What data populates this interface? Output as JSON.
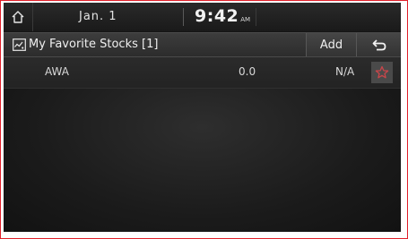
{
  "status_bar": {
    "home_icon": "home-icon",
    "date": "Jan.  1",
    "time": "9:42",
    "ampm": "AM"
  },
  "title_bar": {
    "list_icon": "stock-list-icon",
    "title": "My Favorite Stocks [1]",
    "add_label": "Add",
    "back_icon": "back-arrow-icon"
  },
  "stocks": [
    {
      "name": "AWA",
      "value": "0.0",
      "change": "N/A",
      "favorite_icon": "star-outline-icon"
    }
  ],
  "colors": {
    "frame_border": "#e0202a",
    "star": "#c8464a",
    "text": "#e9e9e9"
  }
}
